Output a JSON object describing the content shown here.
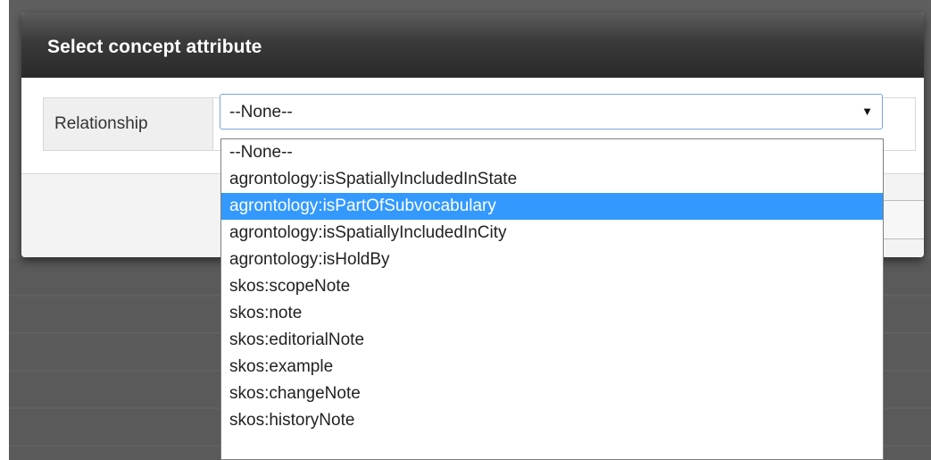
{
  "dialog": {
    "title": "Select concept attribute"
  },
  "form": {
    "label": "Relationship",
    "selected_value": "--None--",
    "arrow": "▼"
  },
  "dropdown": {
    "highlighted_index": 2,
    "options": [
      "--None--",
      "agrontology:isSpatiallyIncludedInState",
      "agrontology:isPartOfSubvocabulary",
      "agrontology:isSpatiallyIncludedInCity",
      "agrontology:isHoldBy",
      "skos:scopeNote",
      "skos:note",
      "skos:editorialNote",
      "skos:example",
      "skos:changeNote",
      "skos:historyNote"
    ]
  },
  "colors": {
    "highlight": "#3399ff",
    "header_dark": "#2a2a2a"
  },
  "icons": {
    "select_arrow": "dropdown-arrow-icon"
  }
}
